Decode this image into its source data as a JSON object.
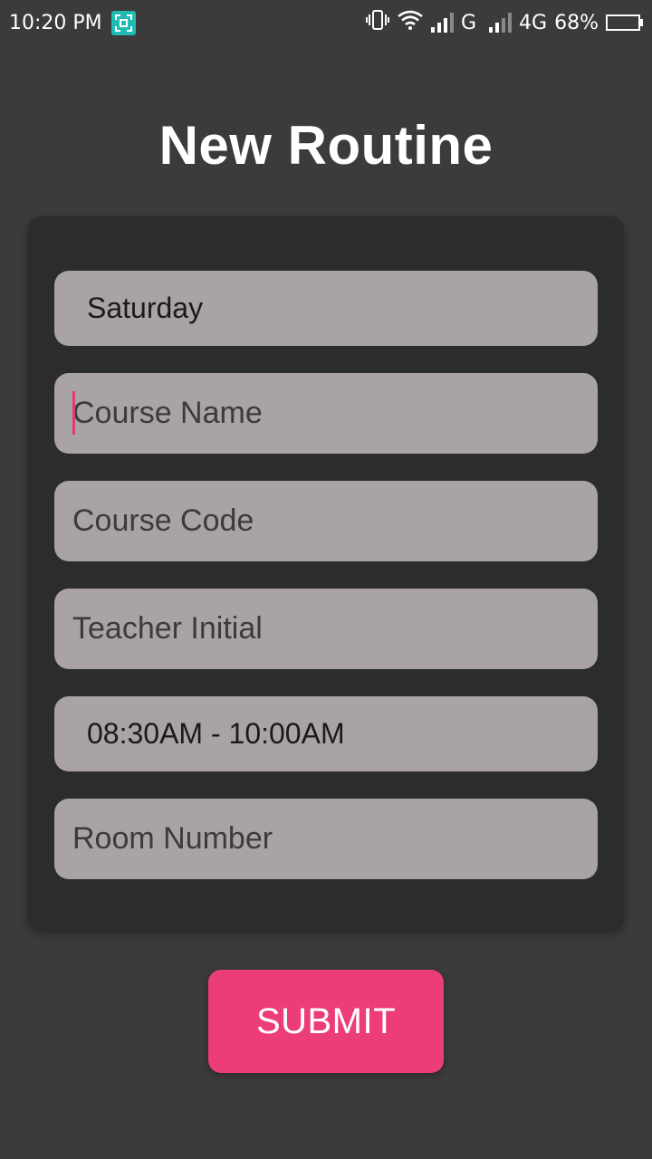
{
  "status_bar": {
    "time": "10:20 PM",
    "network_1": "G",
    "network_2": "4G",
    "battery": "68%",
    "battery_level": 0.68,
    "icons": [
      "screenshot-icon",
      "vibrate-icon",
      "wifi-icon",
      "signal-icon",
      "signal-icon",
      "battery-icon"
    ]
  },
  "page": {
    "title": "New Routine"
  },
  "form": {
    "day_value": "Saturday",
    "course_name_placeholder": "Course Name",
    "course_code_placeholder": "Course Code",
    "teacher_initial_placeholder": "Teacher Initial",
    "time_value": "08:30AM - 10:00AM",
    "room_number_placeholder": "Room Number"
  },
  "actions": {
    "submit_label": "SUBMIT"
  },
  "colors": {
    "background": "#3c3a3b",
    "card": "#2c2c2c",
    "field": "#a9a3a3",
    "accent": "#ec3d7a",
    "cursor": "#e23b74"
  }
}
